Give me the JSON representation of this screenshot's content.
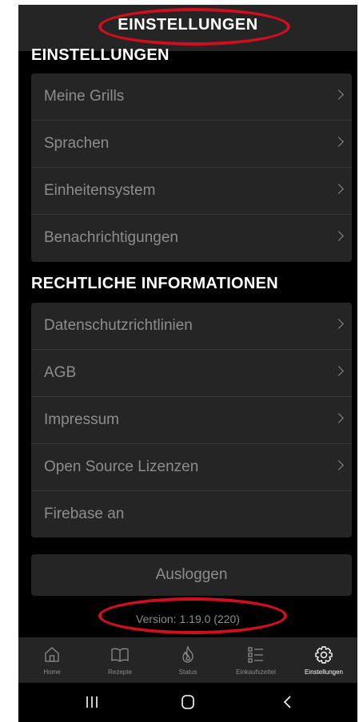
{
  "header": {
    "title": "EINSTELLUNGEN"
  },
  "section_settings": {
    "title": "EINSTELLUNGEN",
    "items": [
      {
        "label": "Meine Grills",
        "chevron": true
      },
      {
        "label": "Sprachen",
        "chevron": true
      },
      {
        "label": "Einheitensystem",
        "chevron": true
      },
      {
        "label": "Benachrichtigungen",
        "chevron": true
      }
    ]
  },
  "section_legal": {
    "title": "RECHTLICHE INFORMATIONEN",
    "items": [
      {
        "label": "Datenschutzrichtlinien",
        "chevron": true
      },
      {
        "label": "AGB",
        "chevron": true
      },
      {
        "label": "Impressum",
        "chevron": true
      },
      {
        "label": "Open Source Lizenzen",
        "chevron": true
      },
      {
        "label": "Firebase an",
        "chevron": false
      }
    ]
  },
  "logout_label": "Ausloggen",
  "version_text": "Version: 1.19.0 (220)",
  "tabbar": {
    "items": [
      {
        "label": "Home",
        "icon": "home-icon",
        "active": false
      },
      {
        "label": "Rezepte",
        "icon": "book-icon",
        "active": false
      },
      {
        "label": "Status",
        "icon": "flame-icon",
        "active": false
      },
      {
        "label": "Einkaufszettel",
        "icon": "list-icon",
        "active": false
      },
      {
        "label": "Einstellungen",
        "icon": "gear-icon",
        "active": true
      }
    ]
  },
  "colors": {
    "background": "#000000",
    "card": "#252525",
    "muted_text": "#8d8d8d",
    "annotation_oval": "#d00e1e"
  }
}
